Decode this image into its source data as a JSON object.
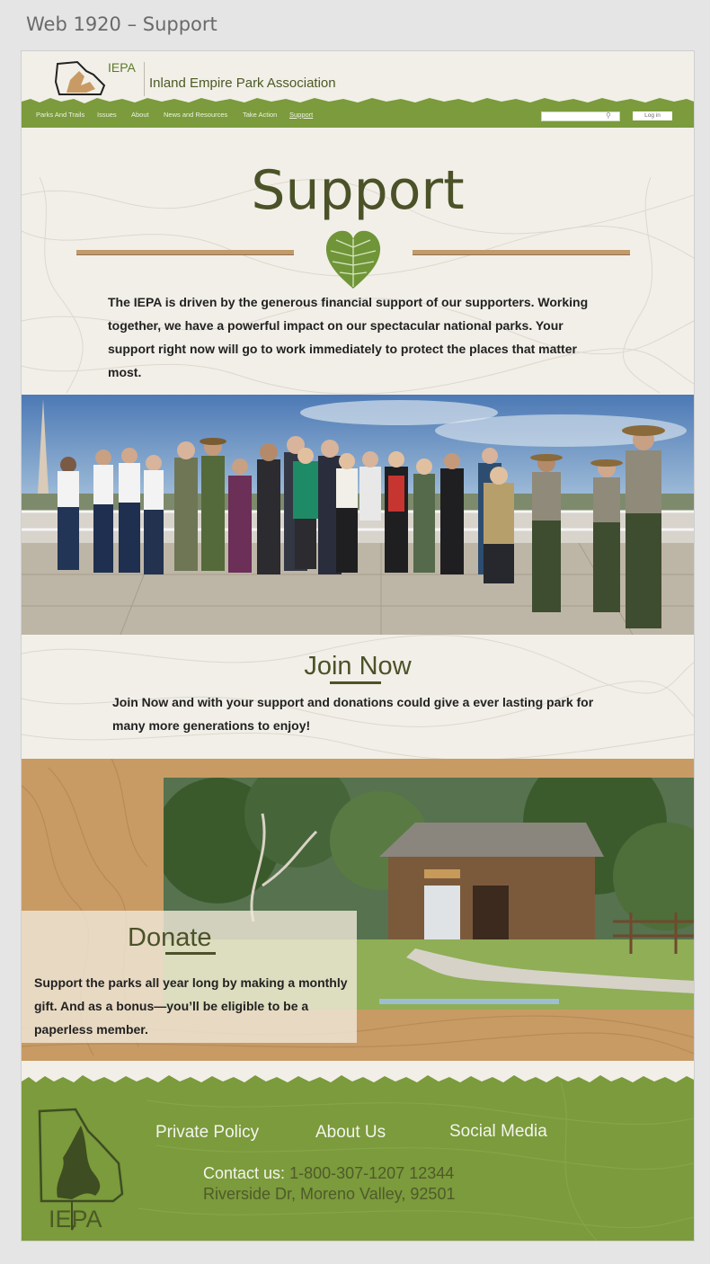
{
  "artboard": {
    "label": "Web 1920 – Support"
  },
  "header": {
    "logo_abbr": "IEPA",
    "org_name": "Inland Empire Park Association",
    "nav": [
      {
        "label": "Parks And Trails"
      },
      {
        "label": "Issues"
      },
      {
        "label": "About"
      },
      {
        "label": "News and Resources"
      },
      {
        "label": "Take Action"
      },
      {
        "label": "Support",
        "active": true
      }
    ],
    "search": {
      "value": "",
      "placeholder": ""
    },
    "login_label": "Log in"
  },
  "hero": {
    "title": "Support",
    "intro": "The IEPA is driven by the generous financial support of our supporters. Working together, we have a powerful impact on our spectacular national parks. Your support right now will go to work immediately to protect the places that matter most."
  },
  "join": {
    "title": "Join Now",
    "text": "Join Now and with your support and donations could give a ever lasting park for many more generations to enjoy!"
  },
  "donate": {
    "title": "Donate",
    "text": "Support the parks all year long by making a monthly gift. And as a bonus—you’ll be eligible to be a paperless member."
  },
  "footer": {
    "logo_text": "IEPA",
    "links": [
      "Private Policy",
      "About Us",
      "Social Media"
    ],
    "contact_label": "Contact us:",
    "contact_phone": "1-800-307-1207",
    "contact_address_1": "12344",
    "contact_address_2": "Riverside Dr, Moreno Valley, 92501"
  },
  "icons": {
    "logo": "california-county-map-icon",
    "divider": "leaf-heart-icon",
    "search": "search-icon"
  },
  "colors": {
    "nav_green": "#7b9b3c",
    "heading_olive": "#4b5228",
    "tan": "#c89b65",
    "background": "#f2efe8"
  }
}
